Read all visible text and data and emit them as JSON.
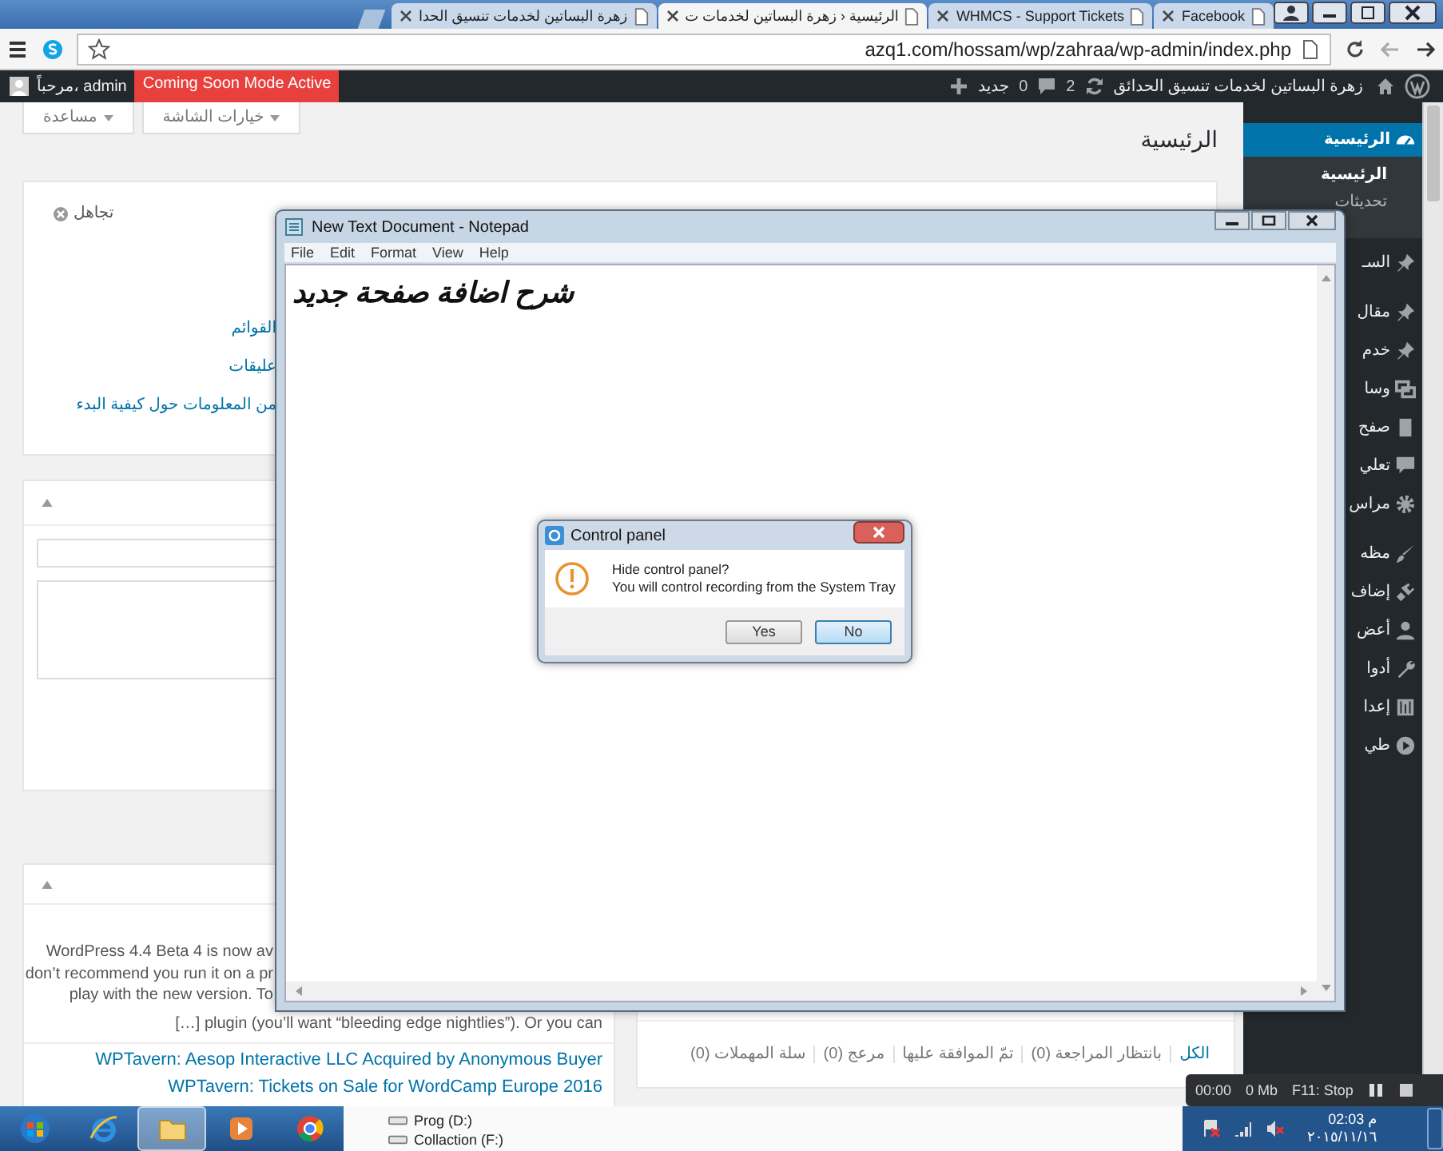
{
  "browser": {
    "tabs": [
      {
        "label": "Facebook",
        "selected": false
      },
      {
        "label": "WHMCS - Support Tickets",
        "selected": false
      },
      {
        "label": "الرئيسية ‹ زهرة البساتين لخدمات ت",
        "selected": true
      },
      {
        "label": "زهرة البساتين لخدمات تنسيق الحدا",
        "selected": false
      }
    ],
    "address": "azq1.com/hossam/wp/zahraa/wp-admin/index.php"
  },
  "admin_bar": {
    "greeting": "مرحباً، admin",
    "coming_soon": "Coming Soon Mode Active",
    "site_name": "زهرة البساتين لخدمات تنسيق الحدائق",
    "updates": "2",
    "comments": "0",
    "new": "جديد"
  },
  "screen_buttons": [
    "خيارات الشاشة",
    "مساعدة"
  ],
  "page_title": "الرئيسية",
  "welcome": {
    "dismiss": "تجاهل",
    "links": [
      "القوائم",
      "عليقات",
      "من المعلومات حول كيفية البدء"
    ]
  },
  "news": {
    "fragments": [
      "WordPress 4.4 Beta 4 is now av",
      "don’t recommend you run it on a pr",
      "play with the new version. To"
    ],
    "last_line": "[…] plugin (you’ll want “bleeding edge nightlies”). Or you can",
    "links": [
      "WPTavern: Aesop Interactive LLC Acquired by Anonymous Buyer",
      "WPTavern: Tickets on Sale for WordCamp Europe 2016"
    ]
  },
  "comment_filters": [
    "الكل",
    "بانتظار المراجعة (0)",
    "تمّ الموافقة عليها",
    "مرعج (0)",
    "سلة المهملات (0)"
  ],
  "sidebar": {
    "groups": [
      [
        {
          "label": "الرئيسية",
          "selected": true,
          "children": [
            {
              "label": "الرئيسية",
              "selected": true
            },
            {
              "label": "تحديثات",
              "selected": false
            }
          ]
        },
        {
          "label": "السـ",
          "selected": false
        }
      ],
      [
        {
          "label": "مقال",
          "selected": false
        },
        {
          "label": "خدم",
          "selected": false
        },
        {
          "label": "وسا",
          "selected": false
        },
        {
          "label": "صفح",
          "selected": false
        },
        {
          "label": "تعلي",
          "selected": false
        },
        {
          "label": "مراس",
          "selected": false
        }
      ],
      [
        {
          "label": "مظه",
          "selected": false
        },
        {
          "label": "إضاف",
          "selected": false
        },
        {
          "label": "أعض",
          "selected": false
        },
        {
          "label": "أدوا",
          "selected": false
        },
        {
          "label": "إعدا",
          "selected": false
        },
        {
          "label": "طي",
          "selected": false
        }
      ]
    ]
  },
  "notepad": {
    "title": "New Text Document - Notepad",
    "menu": [
      "Help",
      "View",
      "Format",
      "Edit",
      "File"
    ],
    "text": "شرح اضافة صفحة جديد"
  },
  "dialog": {
    "title": "Control panel",
    "question": "Hide control panel?",
    "message": "You will control recording from the System Tray",
    "buttons": [
      {
        "label": "No",
        "focused": true
      },
      {
        "label": "Yes",
        "focused": false
      }
    ]
  },
  "recorder": {
    "time": "00:00",
    "size": "0 Mb",
    "stop": "F11: Stop"
  },
  "taskbar": {
    "pinned": [
      {
        "selected": false
      },
      {
        "selected": false
      },
      {
        "selected": true
      },
      {
        "selected": false
      },
      {
        "selected": false
      }
    ],
    "drives": [
      "Prog (D:)",
      "Collaction (F:)"
    ],
    "time": "02:03 م",
    "date": "٢٠١٥/١١/١٦"
  }
}
